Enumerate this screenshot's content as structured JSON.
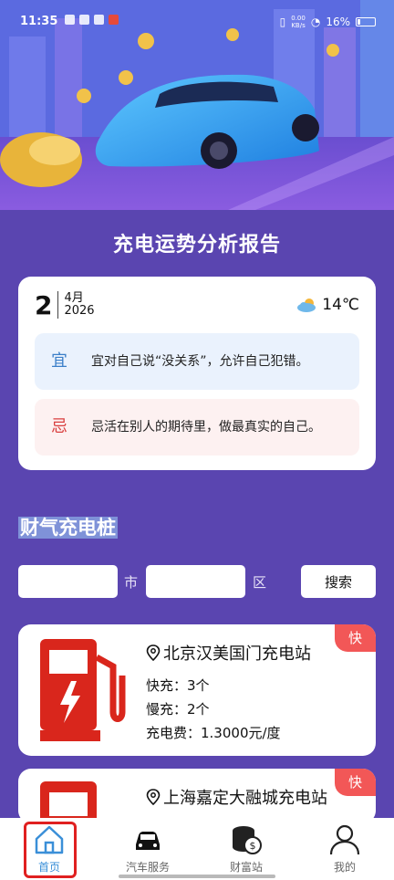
{
  "status_bar": {
    "time": "11:35",
    "net_speed": "0.00\nKB/s",
    "battery": "16%"
  },
  "report": {
    "title": "充电运势分析报告"
  },
  "fortune": {
    "day": "2",
    "month": "4月",
    "year": "2026",
    "temperature": "14℃",
    "weather_icon": "cloudy-sun-icon",
    "yi_label": "宜",
    "yi_text": "宜对自己说“没关系”，允许自己犯错。",
    "ji_label": "忌",
    "ji_text": "忌活在别人的期待里，做最真实的自己。"
  },
  "charging_section": {
    "title": "财气充电桩",
    "city_suffix": "市",
    "district_suffix": "区",
    "search_label": "搜索",
    "city_value": "",
    "district_value": ""
  },
  "stations": [
    {
      "name": "北京汉美国门充电站",
      "fast": "快充：3个",
      "slow": "慢充：2个",
      "fee": "充电费：1.3000元/度",
      "badge": "快"
    },
    {
      "name": "上海嘉定大融城充电站",
      "badge": "快"
    }
  ],
  "tabs": [
    {
      "label": "首页"
    },
    {
      "label": "汽车服务"
    },
    {
      "label": "财富站"
    },
    {
      "label": "我的"
    }
  ],
  "colors": {
    "background": "#5a45b0",
    "accent": "#3a8fd8",
    "badge": "#f25757",
    "pump": "#d9261c"
  }
}
